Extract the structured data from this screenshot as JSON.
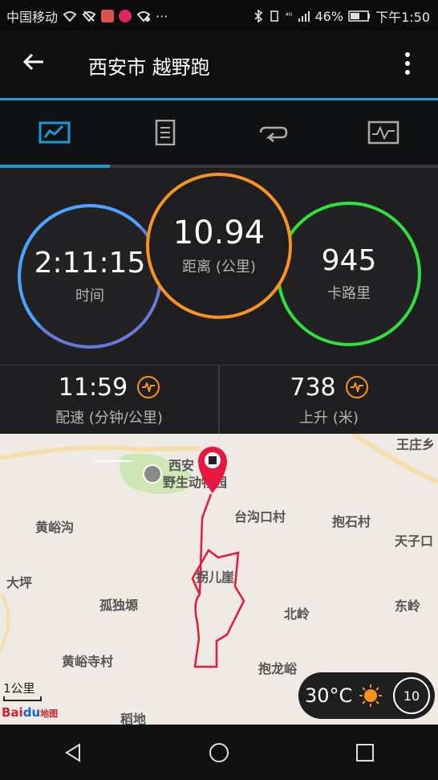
{
  "status_bar": {
    "carrier": "中国移动",
    "indicators": "⁴ᴳ",
    "battery": "46%",
    "time": "下午1:50",
    "more": "···"
  },
  "app_bar": {
    "title": "西安市 越野跑",
    "back_icon": "back-arrow-icon",
    "menu_icon": "more-vert-icon"
  },
  "tabs": [
    {
      "name": "overview",
      "icon": "chart-icon",
      "active": true
    },
    {
      "name": "details",
      "icon": "document-icon",
      "active": false
    },
    {
      "name": "laps",
      "icon": "loop-icon",
      "active": false
    },
    {
      "name": "graphs",
      "icon": "graph-icon",
      "active": false
    }
  ],
  "stats": {
    "time": {
      "value": "2:11:15",
      "label": "时间"
    },
    "distance": {
      "value": "10.94",
      "label": "距离 (公里)"
    },
    "calories": {
      "value": "945",
      "label": "卡路里"
    }
  },
  "metrics": {
    "pace": {
      "value": "11:59",
      "label": "配速 (分钟/公里)"
    },
    "ascent": {
      "value": "738",
      "label": "上升 (米)"
    }
  },
  "map": {
    "labels": {
      "zoo_line1": "西安",
      "zoo_line2": "野生动物园",
      "tai_gou": "台沟口村",
      "bao_shi": "抱石村",
      "huang_yu": "黄峪沟",
      "tianzi": "天子口",
      "dapng": "大坪",
      "guaner": "拐儿崖",
      "gudu": "孤独塬",
      "beiling": "北岭",
      "dongling": "东岭",
      "huangyu_si": "黄峪寺村",
      "baolong": "抱龙峪",
      "daodi": "稻地",
      "wangzhuang": "王庄乡"
    },
    "scale_label": "1公里",
    "logo_text_a": "Bai",
    "logo_text_b": "du",
    "logo_text_c": "地图"
  },
  "weather": {
    "temp": "30°C",
    "wind_speed": "10"
  },
  "nav": {
    "back": "back-triangle-icon",
    "home": "home-circle-icon",
    "recent": "recent-square-icon"
  },
  "colors": {
    "accent": "#1a9bd7",
    "orange": "#f7931e",
    "green": "#2de03c",
    "route": "#e8173f"
  }
}
